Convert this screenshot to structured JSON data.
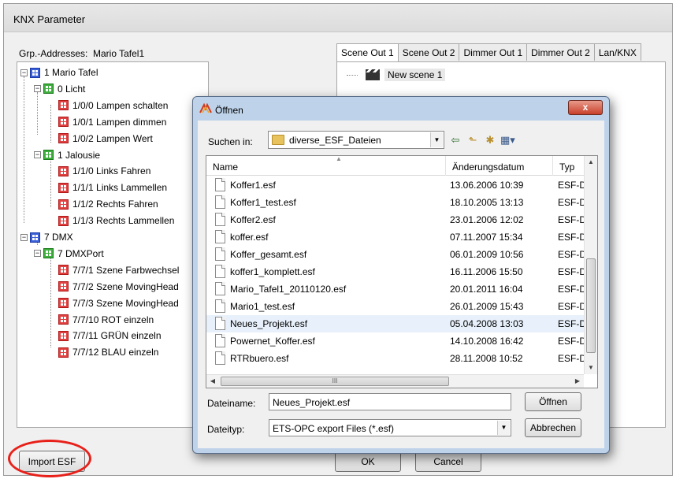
{
  "window": {
    "title": "KNX Parameter"
  },
  "grp": {
    "label": "Grp.-Addresses:",
    "value": "Mario Tafel1"
  },
  "tree": [
    {
      "label": "1 Mario Tafel",
      "type": "group-blue",
      "expander": "−"
    },
    {
      "label": "0 Licht",
      "type": "group-green",
      "expander": "−"
    },
    {
      "label": "1/0/0 Lampen schalten",
      "type": "address"
    },
    {
      "label": "1/0/1 Lampen dimmen",
      "type": "address"
    },
    {
      "label": "1/0/2 Lampen Wert",
      "type": "address"
    },
    {
      "label": "1 Jalousie",
      "type": "group-green",
      "expander": "−"
    },
    {
      "label": "1/1/0 Links Fahren",
      "type": "address"
    },
    {
      "label": "1/1/1 Links Lammellen",
      "type": "address"
    },
    {
      "label": "1/1/2 Rechts Fahren",
      "type": "address"
    },
    {
      "label": "1/1/3 Rechts Lammellen",
      "type": "address"
    },
    {
      "label": "7 DMX",
      "type": "group-blue",
      "expander": "−"
    },
    {
      "label": "7 DMXPort",
      "type": "group-green",
      "expander": "−"
    },
    {
      "label": "7/7/1 Szene Farbwechsel",
      "type": "address"
    },
    {
      "label": "7/7/2 Szene MovingHead",
      "type": "address"
    },
    {
      "label": "7/7/3 Szene MovingHead",
      "type": "address"
    },
    {
      "label": "7/7/10 ROT einzeln",
      "type": "address"
    },
    {
      "label": "7/7/11 GRÜN einzeln",
      "type": "address"
    },
    {
      "label": "7/7/12 BLAU einzeln",
      "type": "address"
    }
  ],
  "tabs": [
    "Scene Out 1",
    "Scene Out 2",
    "Dimmer Out 1",
    "Dimmer Out 2",
    "Lan/KNX"
  ],
  "scene": {
    "item": "New scene 1"
  },
  "buttons": {
    "import": "Import ESF",
    "ok": "OK",
    "cancel": "Cancel"
  },
  "dialog": {
    "title": "Öffnen",
    "close": "x",
    "lookin_label": "Suchen in:",
    "lookin_value": "diverse_ESF_Dateien",
    "columns": {
      "name": "Name",
      "date": "Änderungsdatum",
      "type": "Typ"
    },
    "files": [
      {
        "name": "Koffer1.esf",
        "date": "13.06.2006 10:39",
        "type": "ESF-D"
      },
      {
        "name": "Koffer1_test.esf",
        "date": "18.10.2005 13:13",
        "type": "ESF-D"
      },
      {
        "name": "Koffer2.esf",
        "date": "23.01.2006 12:02",
        "type": "ESF-D"
      },
      {
        "name": "koffer.esf",
        "date": "07.11.2007 15:34",
        "type": "ESF-D"
      },
      {
        "name": "Koffer_gesamt.esf",
        "date": "06.01.2009 10:56",
        "type": "ESF-D"
      },
      {
        "name": "koffer1_komplett.esf",
        "date": "16.11.2006 15:50",
        "type": "ESF-D"
      },
      {
        "name": "Mario_Tafel1_20110120.esf",
        "date": "20.01.2011 16:04",
        "type": "ESF-D"
      },
      {
        "name": "Mario1_test.esf",
        "date": "26.01.2009 15:43",
        "type": "ESF-D"
      },
      {
        "name": "Neues_Projekt.esf",
        "date": "05.04.2008 13:03",
        "type": "ESF-D"
      },
      {
        "name": "Powernet_Koffer.esf",
        "date": "14.10.2008 16:42",
        "type": "ESF-D"
      },
      {
        "name": "RTRbuero.esf",
        "date": "28.11.2008 10:52",
        "type": "ESF-D"
      }
    ],
    "selected_index": 8,
    "filename_label": "Dateiname:",
    "filename_value": "Neues_Projekt.esf",
    "filetype_label": "Dateityp:",
    "filetype_value": "ETS-OPC export Files (*.esf)",
    "open_button": "Öffnen",
    "cancel_button": "Abbrechen",
    "hscroll_grip": "III"
  },
  "colors": {
    "highlight_circle": "#e8201a",
    "selection": "#dceafc"
  }
}
